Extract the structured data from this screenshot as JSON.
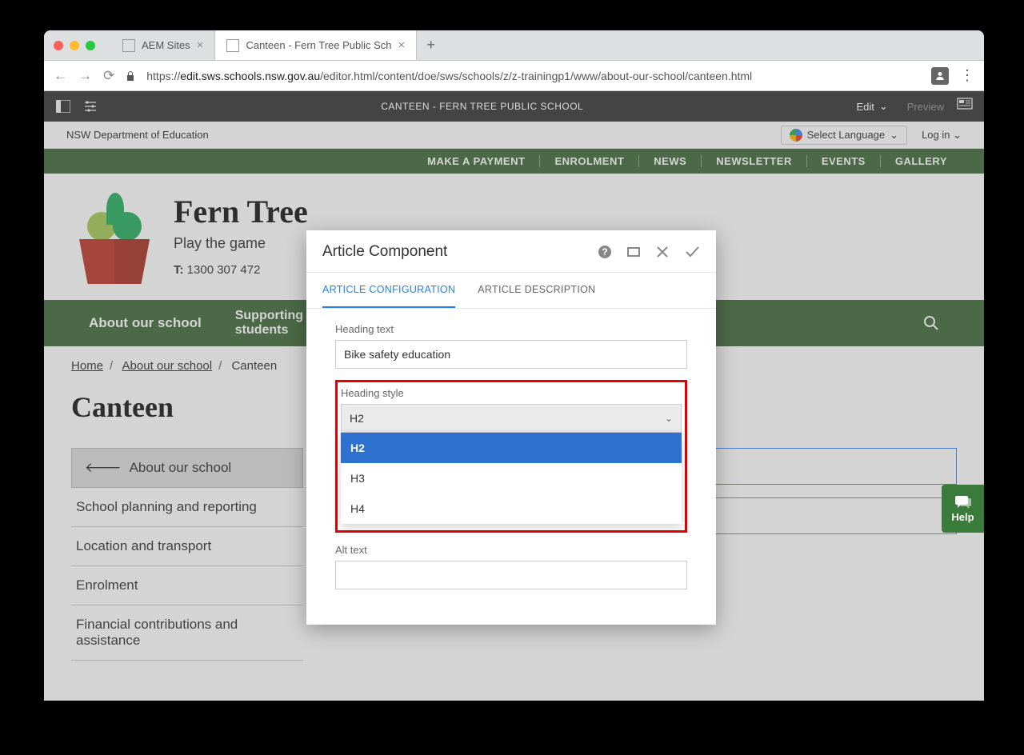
{
  "browser": {
    "tabs": [
      {
        "label": "AEM Sites",
        "active": false
      },
      {
        "label": "Canteen - Fern Tree Public Sch",
        "active": true
      }
    ],
    "url_prefix": "https://",
    "url_host": "edit.sws.schools.nsw.gov.au",
    "url_path": "/editor.html/content/doe/sws/schools/z/z-trainingp1/www/about-our-school/canteen.html"
  },
  "aem": {
    "title": "CANTEEN - FERN TREE PUBLIC SCHOOL",
    "edit": "Edit",
    "preview": "Preview"
  },
  "util": {
    "dept": "NSW Department of Education",
    "lang": "Select Language",
    "login": "Log in"
  },
  "topnav": [
    "MAKE A PAYMENT",
    "ENROLMENT",
    "NEWS",
    "NEWSLETTER",
    "EVENTS",
    "GALLERY"
  ],
  "school": {
    "name": "Fern Tree",
    "tagline": "Play the game",
    "phone_label": "T:",
    "phone": "1300 307 472"
  },
  "mainnav": [
    {
      "label": "About our school"
    },
    {
      "label": "Supporting our\nstudents"
    }
  ],
  "crumbs": {
    "home": "Home",
    "about": "About our school",
    "current": "Canteen"
  },
  "pagetitle": "Canteen",
  "sidenav": {
    "back": "About our school",
    "items": [
      "School planning and reporting",
      "Location and transport",
      "Enrolment",
      "Financial contributions and assistance"
    ]
  },
  "dialog": {
    "title": "Article Component",
    "tab1": "ARTICLE CONFIGURATION",
    "tab2": "ARTICLE DESCRIPTION",
    "heading_text_label": "Heading text",
    "heading_text_value": "Bike safety education",
    "heading_style_label": "Heading style",
    "heading_style_value": "H2",
    "options": [
      "H2",
      "H3",
      "H4"
    ],
    "alt_label": "Alt text"
  },
  "help": "Help"
}
